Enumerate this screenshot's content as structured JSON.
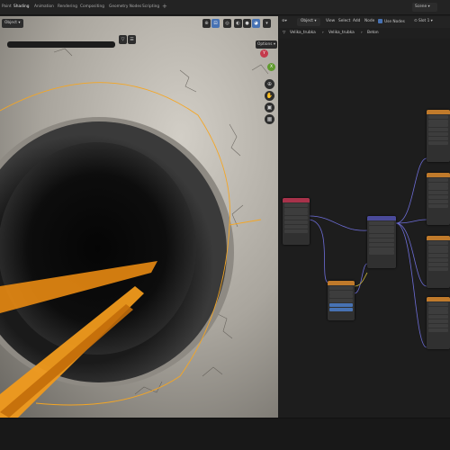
{
  "topbar": {
    "tabs": [
      "Paint",
      "Shading",
      "Animation",
      "Rendering",
      "Compositing",
      "Geometry Nodes",
      "Scripting"
    ],
    "active_tab": "Shading",
    "add_tab": "+",
    "scene": "Scene"
  },
  "viewport": {
    "mode": "Object",
    "options_label": "Options",
    "gizmo_y": "Y",
    "gizmo_x": "X",
    "nav_icons": [
      "zoom-icon",
      "hand-icon",
      "camera-icon",
      "grid-icon"
    ],
    "colors": {
      "selection_outline": "#f5a623",
      "light_beam": "#e88a12",
      "surface": "#c8c4bb"
    }
  },
  "node_editor": {
    "type": "Object",
    "menu": [
      "View",
      "Select",
      "Add",
      "Node"
    ],
    "use_nodes": "Use Nodes",
    "slot": "Slot 1",
    "breadcrumb": [
      "Velika_trubka",
      "Velika_trubka",
      "Beton"
    ],
    "colors": {
      "texture_header": "#c07a2b",
      "input_header": "#a8324a",
      "vector_header": "#4a4a9a",
      "link": "#6d6dd8",
      "shader_link": "#5a8c3a"
    }
  }
}
